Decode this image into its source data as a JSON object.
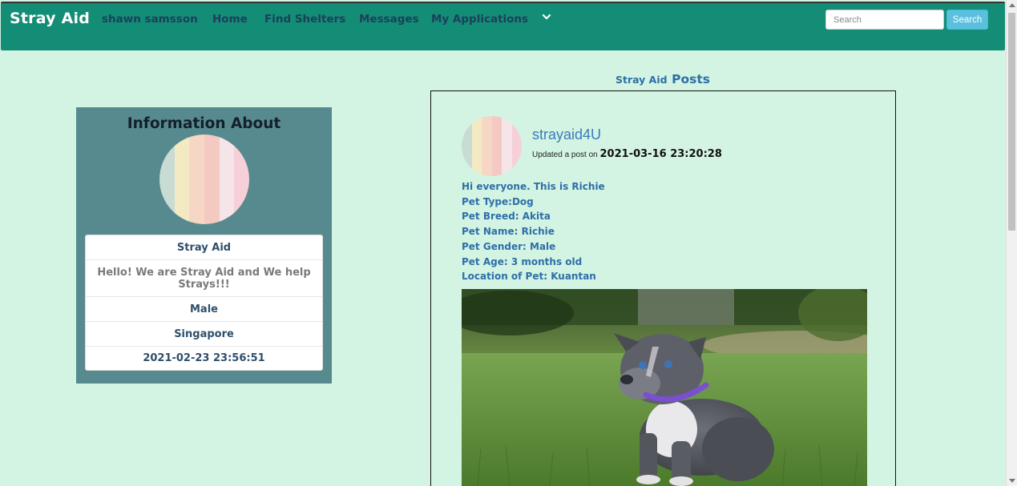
{
  "navbar": {
    "brand": "Stray Aid",
    "links": [
      "shawn samsson",
      "Home",
      "Find Shelters",
      "Messages",
      "My Applications"
    ],
    "search_placeholder": "Search",
    "search_button": "Search"
  },
  "profile": {
    "title": "Information About",
    "items": [
      "Stray Aid",
      "Hello! We are Stray Aid and We help Strays!!!",
      "Male",
      "Singapore",
      "2021-02-23 23:56:51"
    ]
  },
  "posts": {
    "heading_small": "Stray Aid",
    "heading_large": "Posts",
    "post": {
      "username": "strayaid4U",
      "updated_prefix": "Updated a post on",
      "updated_date": "2021-03-16 23:20:28",
      "lines": [
        "Hi everyone. This is Richie",
        "Pet Type:Dog",
        "Pet Breed: Akita",
        "Pet Name: Richie",
        "Pet Gender: Male",
        "Pet Age: 3 months old",
        "Location of Pet: Kuantan"
      ]
    }
  },
  "colors": {
    "navbar": "#138d75",
    "page_bg": "#d3f4e2",
    "profile_bg": "#578a8e",
    "link_text": "#1d3f5c",
    "accent_blue": "#2e6fa8",
    "search_button": "#5bc0de"
  },
  "icons": {
    "dropdown": "chevron-down-icon",
    "avatar": "pastel-stripe-avatar",
    "photo": "puppy-photo"
  }
}
